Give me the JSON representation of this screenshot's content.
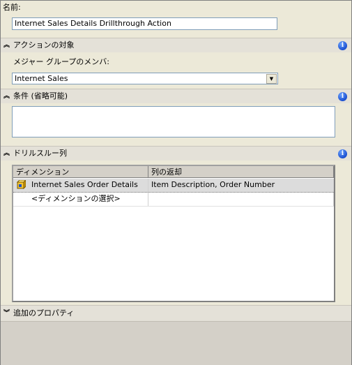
{
  "name_field": {
    "label": "名前:",
    "value": "Internet Sales Details Drillthrough Action"
  },
  "target_section": {
    "title": "アクションの対象",
    "member_label": "メジャー グループのメンバ:",
    "member_value": "Internet Sales"
  },
  "condition_section": {
    "title": "条件 (省略可能)",
    "value": ""
  },
  "drill_section": {
    "title": "ドリルスルー列",
    "columns": [
      "ディメンション",
      "列の返却"
    ],
    "rows": [
      {
        "dimension": "Internet Sales Order Details",
        "returns": "Item Description, Order Number"
      },
      {
        "dimension": "<ディメンションの選択>",
        "returns": ""
      }
    ]
  },
  "extra_section": {
    "title": "追加のプロパティ"
  },
  "icons": {
    "collapse": "chevron-up-double-icon",
    "expand": "chevron-down-double-icon",
    "info": "info-icon",
    "cube": "cube-icon"
  },
  "colors": {
    "info_blue": "#1a4fd0",
    "selected_row": "#dcdcdc"
  }
}
